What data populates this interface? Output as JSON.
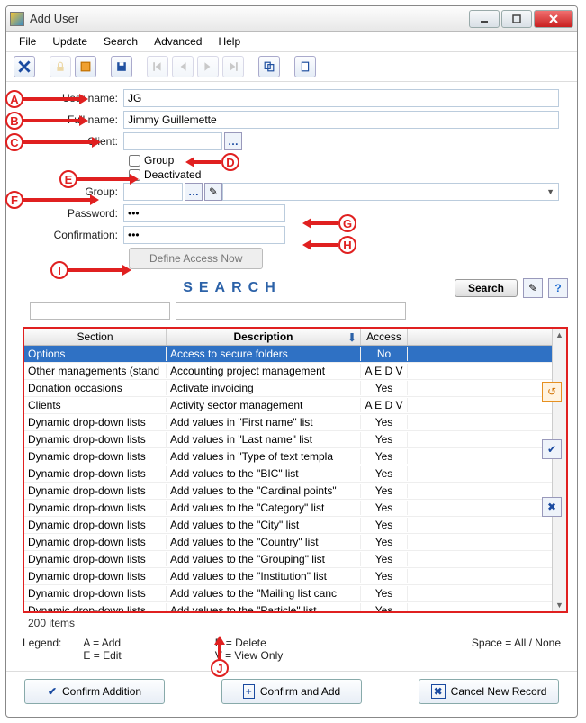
{
  "title": "Add User",
  "menu": [
    "File",
    "Update",
    "Search",
    "Advanced",
    "Help"
  ],
  "fields": {
    "username_label": "User name:",
    "username": "JG",
    "fullname_label": "Full name:",
    "fullname": "Jimmy Guillemette",
    "client_label": "Client:",
    "client": "",
    "group_chk": "Group",
    "deact_chk": "Deactivated",
    "group_label": "Group:",
    "group": "",
    "password_label": "Password:",
    "password": "•••",
    "confirm_label": "Confirmation:",
    "confirm": "•••",
    "define_btn": "Define Access Now"
  },
  "search": {
    "heading": "SEARCH",
    "button": "Search"
  },
  "table": {
    "headers": {
      "section": "Section",
      "description": "Description",
      "access": "Access"
    },
    "rows": [
      {
        "sec": "Options",
        "desc": "Access to secure folders",
        "acc": "No",
        "sel": true
      },
      {
        "sec": "Other managements (stand",
        "desc": "Accounting project management",
        "acc": "A E D V"
      },
      {
        "sec": "Donation occasions",
        "desc": "Activate invoicing",
        "acc": "Yes"
      },
      {
        "sec": "Clients",
        "desc": "Activity sector management",
        "acc": "A E D V"
      },
      {
        "sec": "Dynamic drop-down lists",
        "desc": "Add values in \"First name\" list",
        "acc": "Yes"
      },
      {
        "sec": "Dynamic drop-down lists",
        "desc": "Add values in \"Last name\" list",
        "acc": "Yes"
      },
      {
        "sec": "Dynamic drop-down lists",
        "desc": "Add values in \"Type of text templa",
        "acc": "Yes"
      },
      {
        "sec": "Dynamic drop-down lists",
        "desc": "Add values to the \"BIC\" list",
        "acc": "Yes"
      },
      {
        "sec": "Dynamic drop-down lists",
        "desc": "Add values to the \"Cardinal points\"",
        "acc": "Yes"
      },
      {
        "sec": "Dynamic drop-down lists",
        "desc": "Add values to the \"Category\" list",
        "acc": "Yes"
      },
      {
        "sec": "Dynamic drop-down lists",
        "desc": "Add values to the \"City\" list",
        "acc": "Yes"
      },
      {
        "sec": "Dynamic drop-down lists",
        "desc": "Add values to the \"Country\" list",
        "acc": "Yes"
      },
      {
        "sec": "Dynamic drop-down lists",
        "desc": "Add values to the \"Grouping\" list",
        "acc": "Yes"
      },
      {
        "sec": "Dynamic drop-down lists",
        "desc": "Add values to the \"Institution\" list",
        "acc": "Yes"
      },
      {
        "sec": "Dynamic drop-down lists",
        "desc": "Add values to the \"Mailing list canc",
        "acc": "Yes"
      },
      {
        "sec": "Dynamic drop-down lists",
        "desc": "Add values to the \"Particle\" list",
        "acc": "Yes"
      }
    ],
    "count": "200 items"
  },
  "legend": {
    "label": "Legend:",
    "a": "A = Add",
    "e": "E = Edit",
    "d": "D = Delete",
    "v": "V = View Only",
    "space": "Space = All / None"
  },
  "footer": {
    "confirm": "Confirm Addition",
    "confirm_add": "Confirm and Add",
    "cancel": "Cancel New Record"
  },
  "callouts": [
    "A",
    "B",
    "C",
    "D",
    "E",
    "F",
    "G",
    "H",
    "I",
    "J"
  ]
}
